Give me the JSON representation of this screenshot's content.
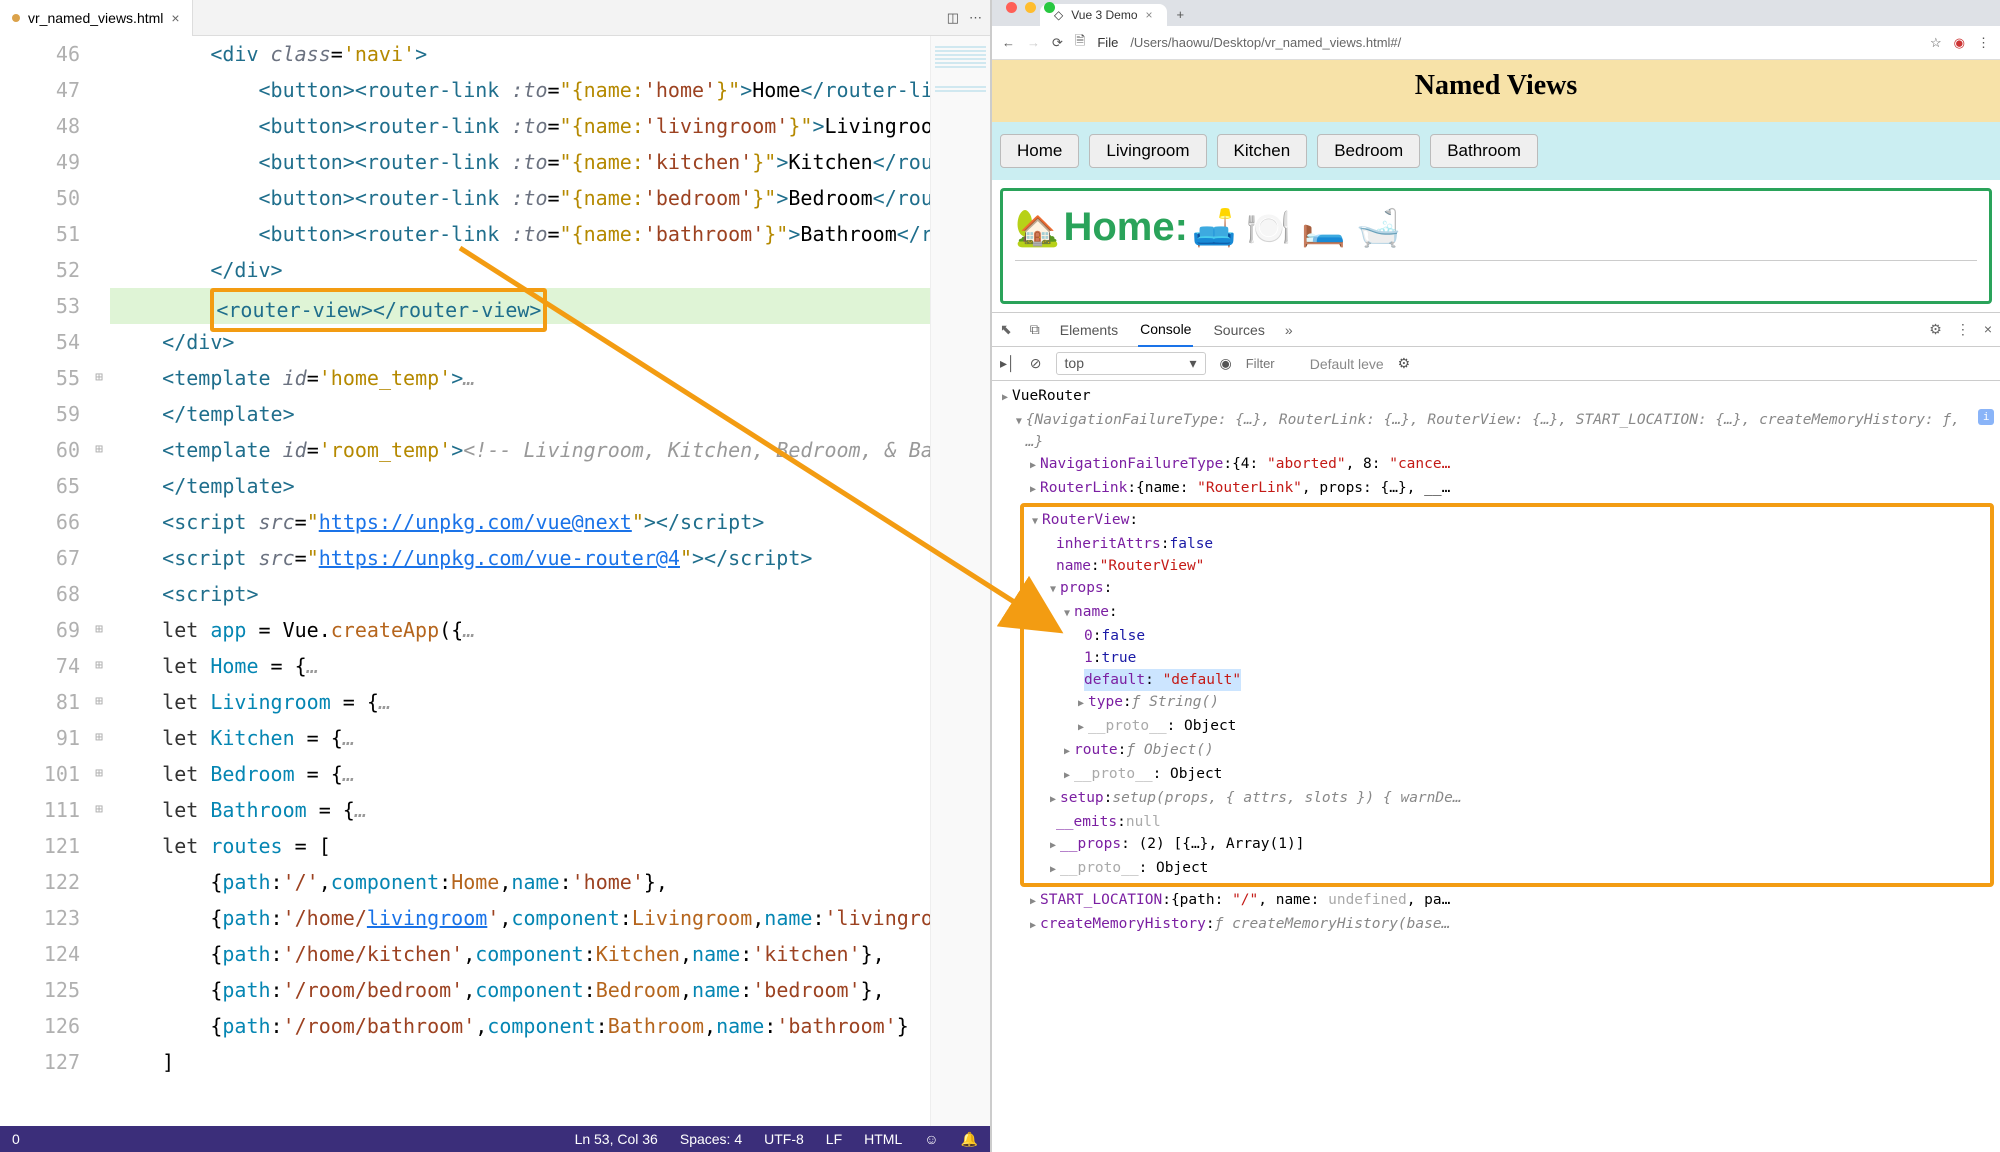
{
  "editor": {
    "tab_filename": "vr_named_views.html",
    "lines": [
      {
        "n": 46,
        "html": "        <span class='c-tag'>&lt;div</span> <span class='c-attr'>class</span>=<span class='c-str'>'navi'</span><span class='c-tag'>&gt;</span>"
      },
      {
        "n": 47,
        "html": "            <span class='c-tag'>&lt;button&gt;&lt;router-link</span> <span class='c-attr'>:to</span>=<span class='c-str'>\"{name:</span><span class='c-strq'>'home'</span><span class='c-str'>}\"</span><span class='c-tag'>&gt;</span>Home<span class='c-tag'>&lt;/router-link&gt;&lt;/button&gt;</span>"
      },
      {
        "n": 48,
        "html": "            <span class='c-tag'>&lt;button&gt;&lt;router-link</span> <span class='c-attr'>:to</span>=<span class='c-str'>\"{name:</span><span class='c-strq'>'livingroom'</span><span class='c-str'>}\"</span><span class='c-tag'>&gt;</span>Livingroom<span class='c-tag'>&lt;/router-lin</span>"
      },
      {
        "n": 49,
        "html": "            <span class='c-tag'>&lt;button&gt;&lt;router-link</span> <span class='c-attr'>:to</span>=<span class='c-str'>\"{name:</span><span class='c-strq'>'kitchen'</span><span class='c-str'>}\"</span><span class='c-tag'>&gt;</span>Kitchen<span class='c-tag'>&lt;/router-link&gt;&lt;/bu</span>"
      },
      {
        "n": 50,
        "html": "            <span class='c-tag'>&lt;button&gt;&lt;router-link</span> <span class='c-attr'>:to</span>=<span class='c-str'>\"{name:</span><span class='c-strq'>'bedroom'</span><span class='c-str'>}\"</span><span class='c-tag'>&gt;</span>Bedroom<span class='c-tag'>&lt;/router-link&gt;&lt;/bu</span>"
      },
      {
        "n": 51,
        "html": "            <span class='c-tag'>&lt;button&gt;&lt;router-link</span> <span class='c-attr'>:to</span>=<span class='c-str'>\"{name:</span><span class='c-strq'>'bathroom'</span><span class='c-str'>}\"</span><span class='c-tag'>&gt;</span>Bathroom<span class='c-tag'>&lt;/router-link&gt;&lt;/</span>"
      },
      {
        "n": 52,
        "html": "        <span class='c-tag'>&lt;/div&gt;</span>"
      },
      {
        "n": 53,
        "hl": true,
        "html": "        <span class='hlbox'><span class='c-tag'>&lt;router-view&gt;&lt;/router-view&gt;</span></span>"
      },
      {
        "n": 54,
        "html": "    <span class='c-tag'>&lt;/div&gt;</span>"
      },
      {
        "n": 55,
        "fold": true,
        "html": "    <span class='c-tag'>&lt;template</span> <span class='c-attr'>id</span>=<span class='c-str'>'home_temp'</span><span class='c-tag'>&gt;</span><span class='c-cmt'>…</span>"
      },
      {
        "n": 59,
        "html": "    <span class='c-tag'>&lt;/template&gt;</span>"
      },
      {
        "n": 60,
        "fold": true,
        "html": "    <span class='c-tag'>&lt;template</span> <span class='c-attr'>id</span>=<span class='c-str'>'room_temp'</span><span class='c-tag'>&gt;</span><span class='c-cmt'>&lt;!-- Livingroom, Kitchen, Bedroom, &amp; Bathroom--&gt;…</span>"
      },
      {
        "n": 65,
        "html": "    <span class='c-tag'>&lt;/template&gt;</span>"
      },
      {
        "n": 66,
        "html": "    <span class='c-tag'>&lt;script</span> <span class='c-attr'>src</span>=<span class='c-str'>\"</span><span class='c-link'>https://unpkg.com/vue@next</span><span class='c-str'>\"</span><span class='c-tag'>&gt;&lt;/script&gt;</span>"
      },
      {
        "n": 67,
        "html": "    <span class='c-tag'>&lt;script</span> <span class='c-attr'>src</span>=<span class='c-str'>\"</span><span class='c-link'>https://unpkg.com/vue-router@4</span><span class='c-str'>\"</span><span class='c-tag'>&gt;&lt;/script&gt;</span>"
      },
      {
        "n": 68,
        "html": "    <span class='c-tag'>&lt;script&gt;</span>"
      },
      {
        "n": 69,
        "fold": true,
        "html": "    <span class='c-kw'>let</span> <span class='c-prop'>app</span> = Vue.<span class='c-fn'>createApp</span>({<span class='c-cmt'>…</span>"
      },
      {
        "n": 74,
        "fold": true,
        "html": "    <span class='c-kw'>let</span> <span class='c-prop'>Home</span> = {<span class='c-cmt'>…</span>"
      },
      {
        "n": 81,
        "fold": true,
        "html": "    <span class='c-kw'>let</span> <span class='c-prop'>Livingroom</span> = {<span class='c-cmt'>…</span>"
      },
      {
        "n": 91,
        "fold": true,
        "html": "    <span class='c-kw'>let</span> <span class='c-prop'>Kitchen</span> = {<span class='c-cmt'>…</span>"
      },
      {
        "n": 101,
        "fold": true,
        "html": "    <span class='c-kw'>let</span> <span class='c-prop'>Bedroom</span> = {<span class='c-cmt'>…</span>"
      },
      {
        "n": 111,
        "fold": true,
        "html": "    <span class='c-kw'>let</span> <span class='c-prop'>Bathroom</span> = {<span class='c-cmt'>…</span>"
      },
      {
        "n": 121,
        "html": "    <span class='c-kw'>let</span> <span class='c-prop'>routes</span> = ["
      },
      {
        "n": 122,
        "html": "        {<span class='c-prop'>path</span>:<span class='c-strq'>'/'</span>,<span class='c-prop'>component</span>:<span class='c-fn'>Home</span>,<span class='c-prop'>name</span>:<span class='c-strq'>'home'</span>},"
      },
      {
        "n": 123,
        "html": "        {<span class='c-prop'>path</span>:<span class='c-strq'>'/home/<span class='c-link'>livingroom</span>'</span>,<span class='c-prop'>component</span>:<span class='c-fn'>Livingroom</span>,<span class='c-prop'>name</span>:<span class='c-strq'>'livingroom'</span>},"
      },
      {
        "n": 124,
        "html": "        {<span class='c-prop'>path</span>:<span class='c-strq'>'/home/kitchen'</span>,<span class='c-prop'>component</span>:<span class='c-fn'>Kitchen</span>,<span class='c-prop'>name</span>:<span class='c-strq'>'kitchen'</span>},"
      },
      {
        "n": 125,
        "html": "        {<span class='c-prop'>path</span>:<span class='c-strq'>'/room/bedroom'</span>,<span class='c-prop'>component</span>:<span class='c-fn'>Bedroom</span>,<span class='c-prop'>name</span>:<span class='c-strq'>'bedroom'</span>},"
      },
      {
        "n": 126,
        "html": "        {<span class='c-prop'>path</span>:<span class='c-strq'>'/room/bathroom'</span>,<span class='c-prop'>component</span>:<span class='c-fn'>Bathroom</span>,<span class='c-prop'>name</span>:<span class='c-strq'>'bathroom'</span>}"
      },
      {
        "n": 127,
        "html": "    ]"
      }
    ],
    "status": {
      "left": "0",
      "pos": "Ln 53, Col 36",
      "spaces": "Spaces: 4",
      "enc": "UTF-8",
      "eol": "LF",
      "lang": "HTML"
    }
  },
  "browser": {
    "tab_title": "Vue 3 Demo",
    "url_prefix": "File",
    "url": "/Users/haowu/Desktop/vr_named_views.html#/",
    "page_title": "Named Views",
    "nav": [
      "Home",
      "Livingroom",
      "Kitchen",
      "Bedroom",
      "Bathroom"
    ],
    "room_label": "Home:",
    "room_emoji_left": "🏡",
    "room_emojis": "🛋️ 🍽️ 🛏️ 🛁"
  },
  "devtools": {
    "tabs": [
      "Elements",
      "Console",
      "Sources"
    ],
    "active_tab": "Console",
    "context": "top",
    "filter_placeholder": "Filter",
    "level": "Default leve",
    "console": {
      "root": "VueRouter",
      "summary": "{NavigationFailureType: {…}, RouterLink: {…}, RouterView: {…}, START_LOCATION: {…}, createMemoryHistory: ƒ, …}",
      "nav_failure": "NavigationFailureType: {4: \"aborted\", 8: \"cance…",
      "router_link": "RouterLink: {name: \"RouterLink\", props: {…}, __…",
      "router_view": {
        "label": "RouterView:",
        "inheritAttrs": "inheritAttrs: false",
        "name": "name: \"RouterView\"",
        "props": "props:",
        "name_sub": "name:",
        "p0": "0: false",
        "p1": "1: true",
        "default": "default: \"default\"",
        "type": "type: ƒ String()",
        "proto1": "__proto__: Object",
        "route": "route: ƒ Object()",
        "proto2": "__proto__: Object",
        "setup": "setup: setup(props, { attrs, slots }) { warnDe…",
        "emits": "__emits: null",
        "props2": "__props: (2) [{…}, Array(1)]",
        "proto3": "__proto__: Object"
      },
      "start_location": "START_LOCATION: {path: \"/\", name: undefined, pa…",
      "create_mem": "createMemoryHistory: ƒ createMemoryHistory(base…"
    }
  }
}
